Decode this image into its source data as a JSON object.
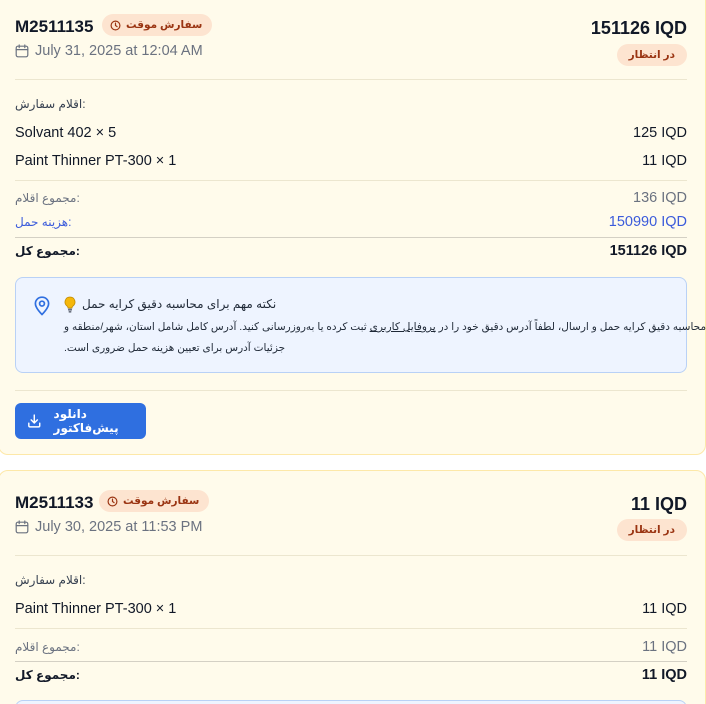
{
  "orders": [
    {
      "id": "M2511135",
      "temp_label": "سفارش موقت",
      "date": "July 31, 2025 at 12:04 AM",
      "total_top": "151126 IQD",
      "status": "در انتظار",
      "items_label": "اقلام سفارش:",
      "items": [
        {
          "name": "Solvant 402 × 5",
          "price": "125 IQD"
        },
        {
          "name": "Paint Thinner PT-300 × 1",
          "price": "11 IQD"
        }
      ],
      "subtotal_label": "مجموع اقلام:",
      "subtotal_value": "136 IQD",
      "shipping_label": "هزینه حمل:",
      "shipping_value": "150990 IQD",
      "grand_label": "مجموع کل:",
      "grand_value": "151126 IQD",
      "notice": {
        "title": "نکته مهم برای محاسبه دقیق کرایه حمل",
        "line1_pre": "برای محاسبه دقیق کرایه حمل و ارسال، لطفاً آدرس دقیق خود را در",
        "line1_link": "پروفایل کاربری",
        "line1_post": "ثبت کرده یا بەروزرسانی کنید. آدرس کامل شامل استان، شهر/منطقه و",
        "line2": "جزئیات آدرس برای تعیین هزینه حمل ضروری است."
      },
      "download_label": "دانلود پیش‌فاکتور"
    },
    {
      "id": "M2511133",
      "temp_label": "سفارش موقت",
      "date": "July 30, 2025 at 11:53 PM",
      "total_top": "11 IQD",
      "status": "در انتظار",
      "items_label": "اقلام سفارش:",
      "items": [
        {
          "name": "Paint Thinner PT-300 × 1",
          "price": "11 IQD"
        }
      ],
      "subtotal_label": "مجموع اقلام:",
      "subtotal_value": "11 IQD",
      "grand_label": "مجموع کل:",
      "grand_value": "11 IQD"
    }
  ],
  "icons": {
    "clock": "clock-icon",
    "calendar": "calendar-icon",
    "location": "location-pin-icon",
    "bulb": "lightbulb-icon",
    "download": "download-icon"
  },
  "colors": {
    "card_bg": "#fffbeb",
    "chip_bg": "#fde4d0",
    "chip_text": "#9a3412",
    "accent_blue": "#2f6fe0",
    "shipping_blue": "#3b5bdb",
    "notice_bg": "#eef4ff"
  }
}
